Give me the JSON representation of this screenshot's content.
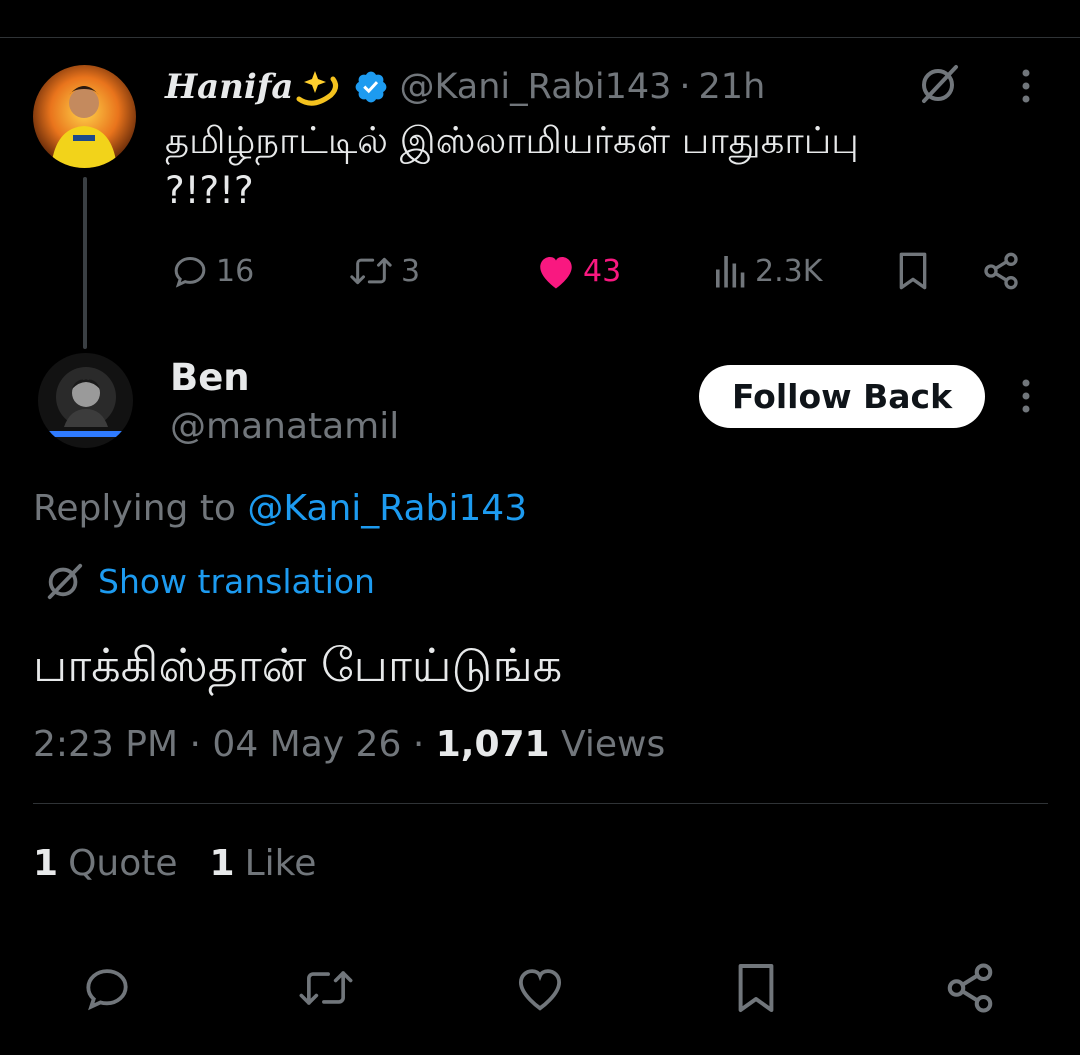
{
  "tweet": {
    "author_name": "Hanifa",
    "author_handle": "@Kani_Rabi143",
    "separator": "·",
    "time_ago": "21h",
    "text": "தமிழ்நாட்டில் இஸ்லாமியர்கள் பாதுகாப்பு ?!?!?",
    "stats": {
      "replies": "16",
      "retweets": "3",
      "likes": "43",
      "views": "2.3K"
    }
  },
  "reply": {
    "author_name": "Ben",
    "author_handle": "@manatamil",
    "follow_button": "Follow Back",
    "replying_prefix": "Replying to ",
    "replying_handle": "@Kani_Rabi143",
    "show_translation": "Show translation",
    "text": "பாக்கிஸ்தான் போய்டுங்க",
    "time": "2:23 PM",
    "separator": "·",
    "date": "04 May 26",
    "views_count": "1,071",
    "views_label": "Views",
    "quote_count": "1",
    "quote_label": "Quote",
    "like_count": "1",
    "like_label": "Like"
  },
  "colors": {
    "background": "#000000",
    "text_primary": "#e7e9ea",
    "text_secondary": "#71767b",
    "accent_blue": "#1d9bf0",
    "like_pink": "#f91880"
  },
  "icons": {
    "sparkle": "dizzy-sparkle-icon",
    "verified": "verified-badge-icon",
    "grok": "grok-icon",
    "more": "more-vertical-icon",
    "reply": "reply-icon",
    "retweet": "retweet-icon",
    "like": "heart-icon",
    "views": "views-icon",
    "bookmark": "bookmark-icon",
    "share": "share-icon",
    "translate": "grok-icon"
  }
}
